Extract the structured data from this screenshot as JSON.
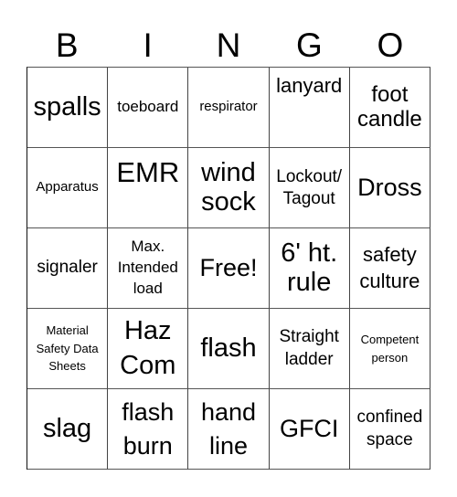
{
  "header": {
    "letters": [
      "B",
      "I",
      "N",
      "G",
      "O"
    ]
  },
  "cells": [
    [
      "spalls",
      "toeboard",
      "respirator",
      "lanyard",
      "foot candle"
    ],
    [
      "Apparatus",
      "EMR",
      "wind sock",
      "Lockout/ Tagout",
      "Dross"
    ],
    [
      "signaler",
      "Max. Intended load",
      "Free!",
      "6' ht. rule",
      "safety culture"
    ],
    [
      "Material Safety Data Sheets",
      "Haz Com",
      "flash",
      "Straight ladder",
      "Competent person"
    ],
    [
      "slag",
      "flash burn",
      "hand line",
      "GFCI",
      "confined space"
    ]
  ]
}
